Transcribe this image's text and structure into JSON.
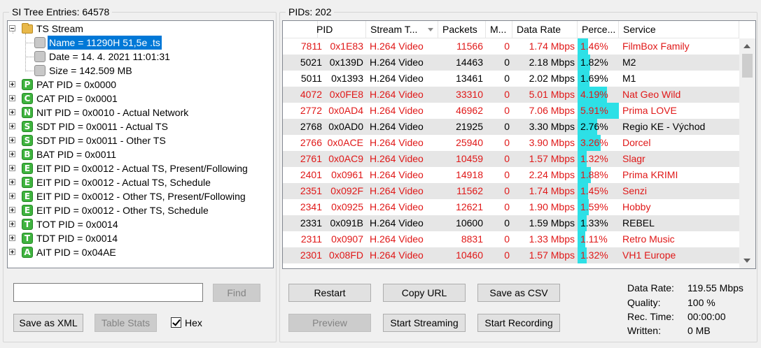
{
  "left_panel": {
    "title": "SI Tree Entries: 64578",
    "tree": [
      {
        "label": "TS Stream",
        "icon": "folder",
        "expander": "minus"
      },
      {
        "label": "Name = 11290H 51,5e .ts",
        "icon": "gray",
        "selected": true
      },
      {
        "label": "Date = 14. 4. 2021 11:01:31",
        "icon": "gray"
      },
      {
        "label": "Size = 142.509 MB",
        "icon": "gray"
      },
      {
        "label": "PAT PID = 0x0000",
        "icon": "P",
        "expander": "plus"
      },
      {
        "label": "CAT PID = 0x0001",
        "icon": "C",
        "expander": "plus"
      },
      {
        "label": "NIT PID = 0x0010 - Actual Network",
        "icon": "N",
        "expander": "plus"
      },
      {
        "label": "SDT PID = 0x0011 - Actual TS",
        "icon": "S",
        "expander": "plus"
      },
      {
        "label": "SDT PID = 0x0011 - Other TS",
        "icon": "S",
        "expander": "plus"
      },
      {
        "label": "BAT PID = 0x0011",
        "icon": "B",
        "expander": "plus"
      },
      {
        "label": "EIT PID = 0x0012 - Actual TS, Present/Following",
        "icon": "E",
        "expander": "plus"
      },
      {
        "label": "EIT PID = 0x0012 - Actual TS, Schedule",
        "icon": "E",
        "expander": "plus"
      },
      {
        "label": "EIT PID = 0x0012 - Other TS, Present/Following",
        "icon": "E",
        "expander": "plus"
      },
      {
        "label": "EIT PID = 0x0012 - Other TS, Schedule",
        "icon": "E",
        "expander": "plus"
      },
      {
        "label": "TOT PID = 0x0014",
        "icon": "T",
        "expander": "plus"
      },
      {
        "label": "TDT PID = 0x0014",
        "icon": "T",
        "expander": "plus"
      },
      {
        "label": "AIT PID = 0x04AE",
        "icon": "A",
        "expander": "plus"
      }
    ],
    "search": {
      "value": "",
      "placeholder": ""
    },
    "find_label": "Find",
    "save_xml_label": "Save as XML",
    "table_stats_label": "Table Stats",
    "hex_label": "Hex",
    "hex_checked": true
  },
  "right_panel": {
    "title": "PIDs: 202",
    "columns": [
      "PID",
      "",
      "Stream T...",
      "Packets",
      "M...",
      "Data Rate",
      "Perce...",
      "Service"
    ],
    "rows": [
      {
        "pid": "7811",
        "hex": "0x1E83",
        "type": "H.264 Video",
        "packets": "11566",
        "m": "0",
        "rate": "1.74 Mbps",
        "pct": "1.46%",
        "pct_value": 1.46,
        "service": "FilmBox Family",
        "red": true
      },
      {
        "pid": "5021",
        "hex": "0x139D",
        "type": "H.264 Video",
        "packets": "14463",
        "m": "0",
        "rate": "2.18 Mbps",
        "pct": "1.82%",
        "pct_value": 1.82,
        "service": "M2",
        "red": false
      },
      {
        "pid": "5011",
        "hex": "0x1393",
        "type": "H.264 Video",
        "packets": "13461",
        "m": "0",
        "rate": "2.02 Mbps",
        "pct": "1.69%",
        "pct_value": 1.69,
        "service": "M1",
        "red": false
      },
      {
        "pid": "4072",
        "hex": "0x0FE8",
        "type": "H.264 Video",
        "packets": "33310",
        "m": "0",
        "rate": "5.01 Mbps",
        "pct": "4.19%",
        "pct_value": 4.19,
        "service": "Nat Geo Wild",
        "red": true
      },
      {
        "pid": "2772",
        "hex": "0x0AD4",
        "type": "H.264 Video",
        "packets": "46962",
        "m": "0",
        "rate": "7.06 Mbps",
        "pct": "5.91%",
        "pct_value": 5.91,
        "service": "Prima LOVE",
        "red": true
      },
      {
        "pid": "2768",
        "hex": "0x0AD0",
        "type": "H.264 Video",
        "packets": "21925",
        "m": "0",
        "rate": "3.30 Mbps",
        "pct": "2.76%",
        "pct_value": 2.76,
        "service": "Regio KE - Východ",
        "red": false
      },
      {
        "pid": "2766",
        "hex": "0x0ACE",
        "type": "H.264 Video",
        "packets": "25940",
        "m": "0",
        "rate": "3.90 Mbps",
        "pct": "3.26%",
        "pct_value": 3.26,
        "service": "Dorcel",
        "red": true
      },
      {
        "pid": "2761",
        "hex": "0x0AC9",
        "type": "H.264 Video",
        "packets": "10459",
        "m": "0",
        "rate": "1.57 Mbps",
        "pct": "1.32%",
        "pct_value": 1.32,
        "service": "Slagr",
        "red": true
      },
      {
        "pid": "2401",
        "hex": "0x0961",
        "type": "H.264 Video",
        "packets": "14918",
        "m": "0",
        "rate": "2.24 Mbps",
        "pct": "1.88%",
        "pct_value": 1.88,
        "service": "Prima KRIMI",
        "red": true
      },
      {
        "pid": "2351",
        "hex": "0x092F",
        "type": "H.264 Video",
        "packets": "11562",
        "m": "0",
        "rate": "1.74 Mbps",
        "pct": "1.45%",
        "pct_value": 1.45,
        "service": "Senzi",
        "red": true
      },
      {
        "pid": "2341",
        "hex": "0x0925",
        "type": "H.264 Video",
        "packets": "12621",
        "m": "0",
        "rate": "1.90 Mbps",
        "pct": "1.59%",
        "pct_value": 1.59,
        "service": "Hobby",
        "red": true
      },
      {
        "pid": "2331",
        "hex": "0x091B",
        "type": "H.264 Video",
        "packets": "10600",
        "m": "0",
        "rate": "1.59 Mbps",
        "pct": "1.33%",
        "pct_value": 1.33,
        "service": "REBEL",
        "red": false
      },
      {
        "pid": "2311",
        "hex": "0x0907",
        "type": "H.264 Video",
        "packets": "8831",
        "m": "0",
        "rate": "1.33 Mbps",
        "pct": "1.11%",
        "pct_value": 1.11,
        "service": "Retro Music",
        "red": true
      },
      {
        "pid": "2301",
        "hex": "0x08FD",
        "type": "H.264 Video",
        "packets": "10460",
        "m": "0",
        "rate": "1.57 Mbps",
        "pct": "1.32%",
        "pct_value": 1.32,
        "service": "VH1 Europe",
        "red": true
      }
    ],
    "buttons": {
      "restart": "Restart",
      "copy_url": "Copy URL",
      "save_csv": "Save as CSV",
      "preview": "Preview",
      "start_streaming": "Start Streaming",
      "start_recording": "Start Recording"
    },
    "stats": {
      "data_rate_label": "Data Rate:",
      "data_rate_value": "119.55 Mbps",
      "quality_label": "Quality:",
      "quality_value": "100 %",
      "rec_time_label": "Rec. Time:",
      "rec_time_value": "00:00:00",
      "written_label": "Written:",
      "written_value": "0 MB"
    }
  },
  "colors": {
    "selection": "#0078d7",
    "percent_bar": "#2de0e6",
    "red_text": "#e01818",
    "alt_row": "#e6e6e6"
  },
  "icons": {
    "tree_expand": "plus-box-icon",
    "tree_collapse": "minus-box-icon",
    "folder": "folder-icon",
    "table_entry": "gray-square-icon"
  }
}
